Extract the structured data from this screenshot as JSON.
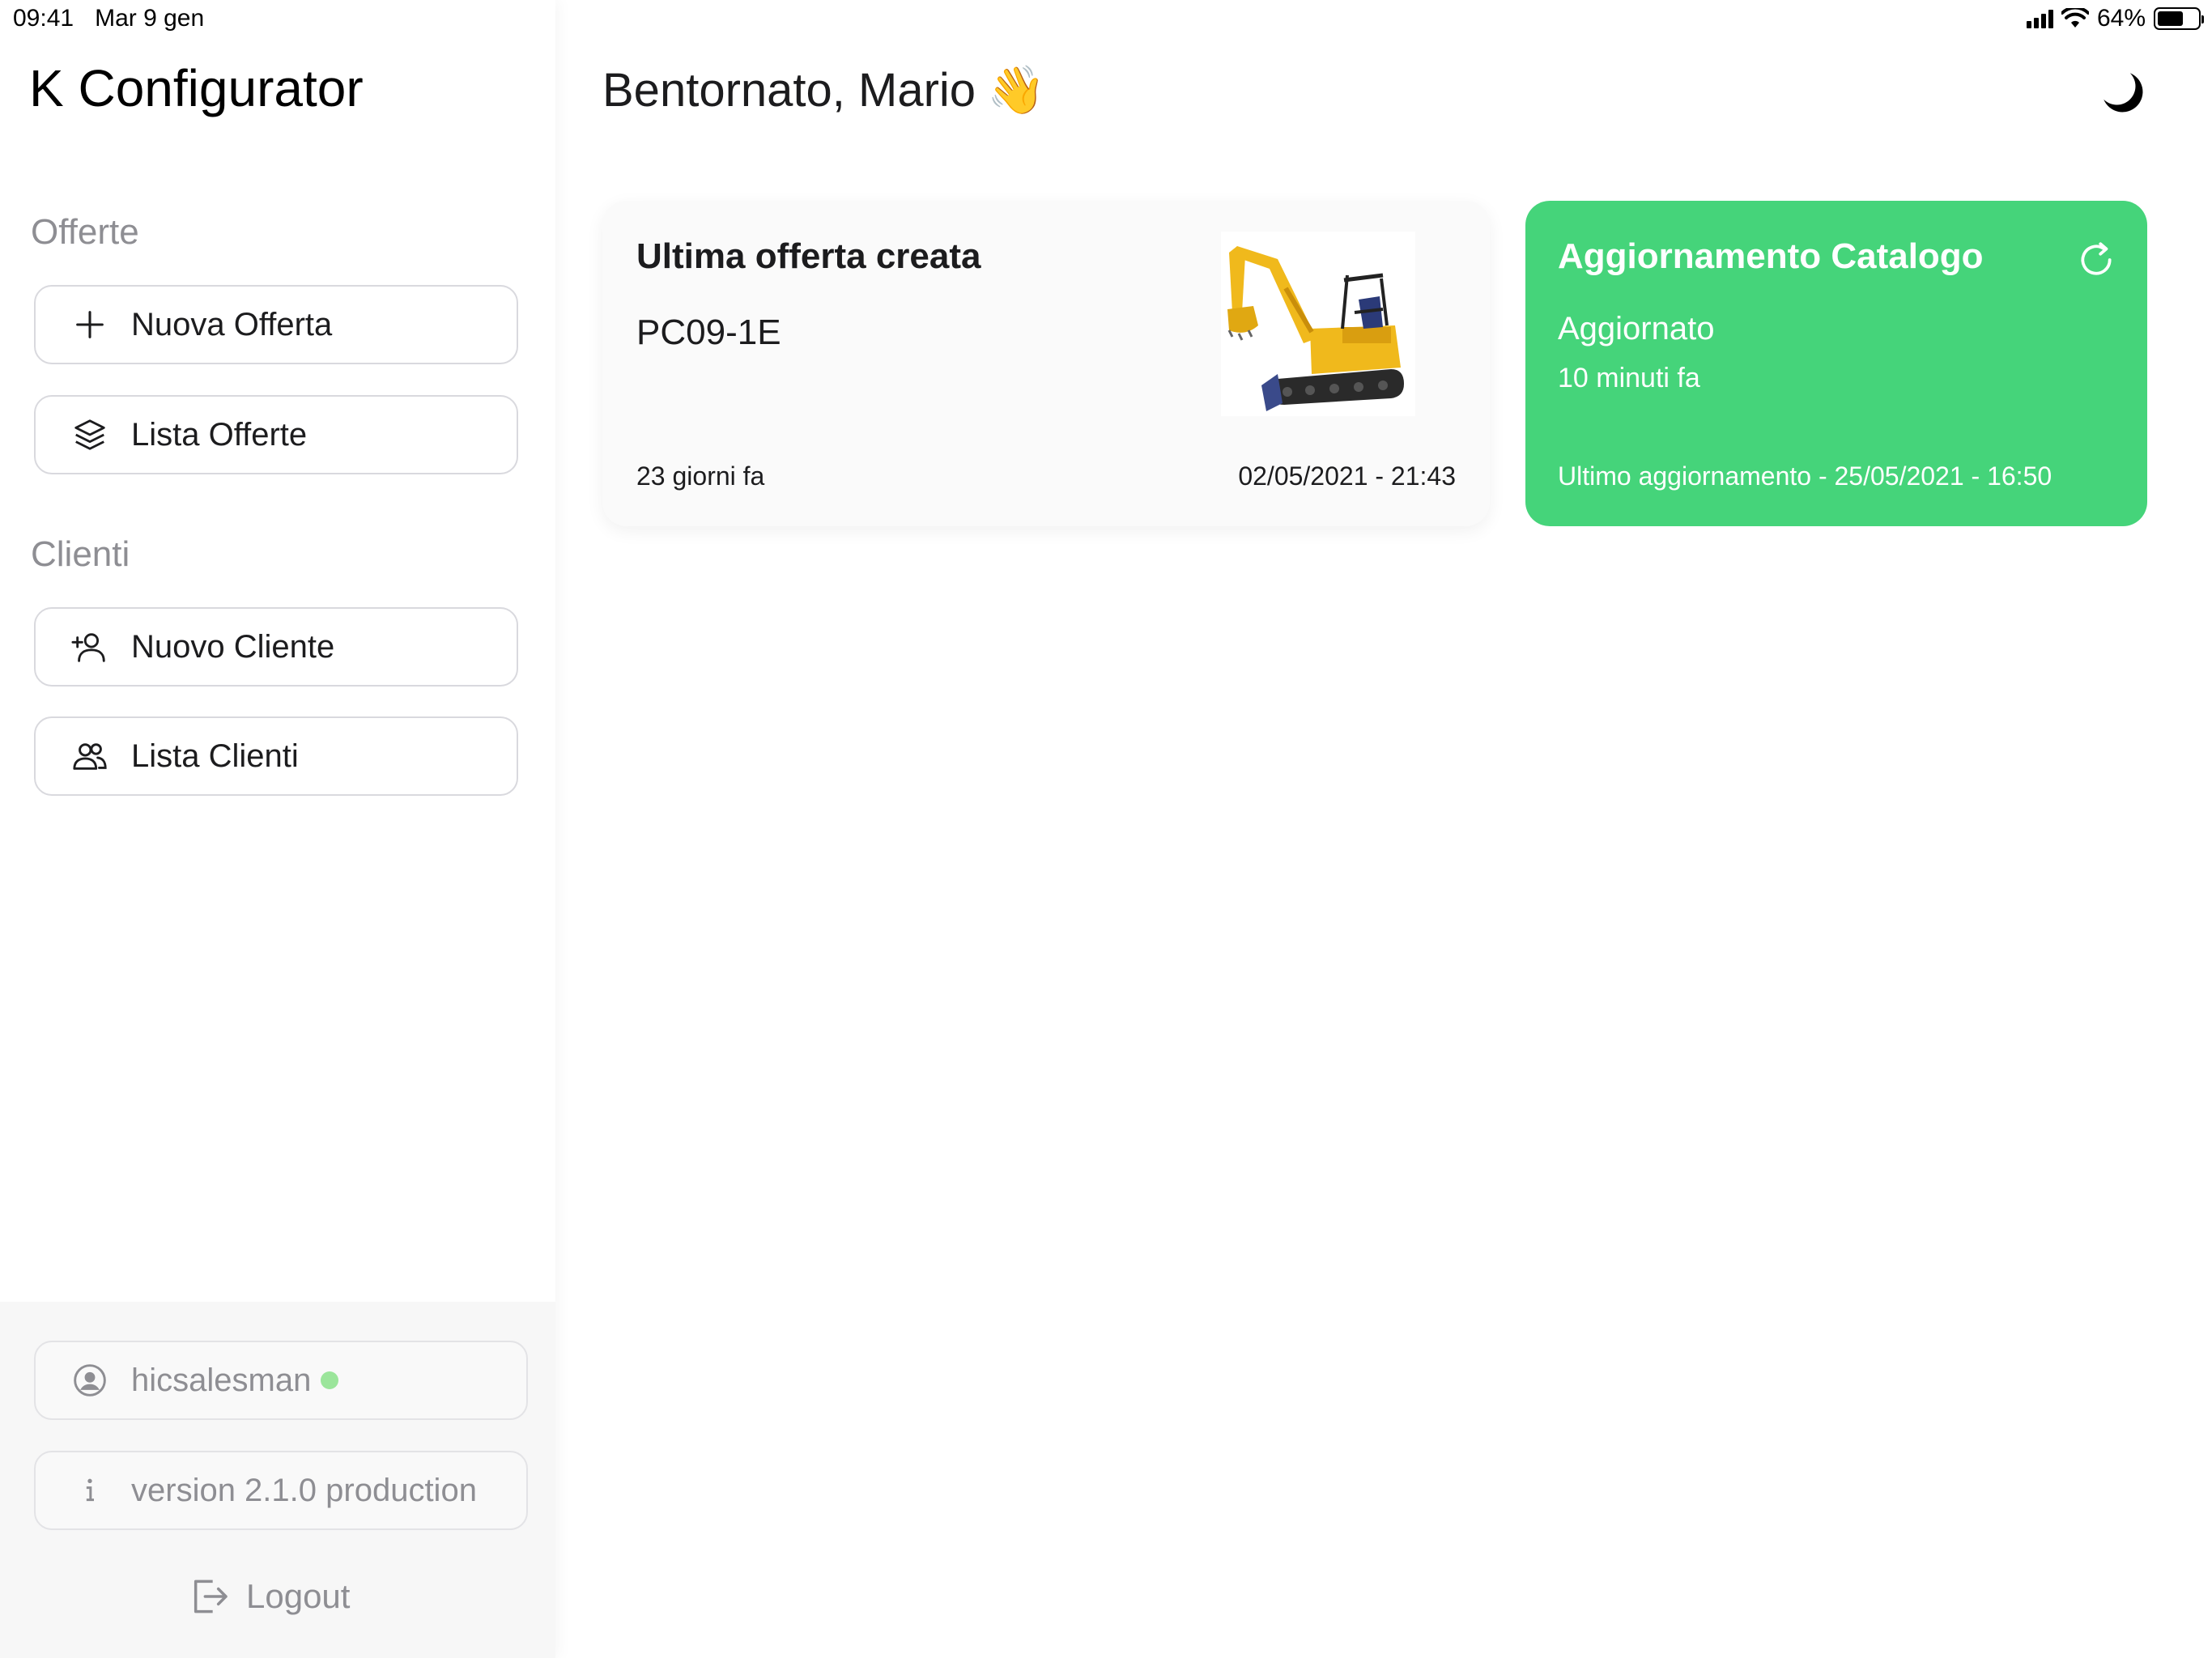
{
  "statusbar": {
    "time": "09:41",
    "date": "Mar 9 gen",
    "battery": "64%",
    "battery_level": 0.64
  },
  "sidebar": {
    "app_title": "K Configurator",
    "sections": [
      {
        "title": "Offerte",
        "items": [
          {
            "label": "Nuova Offerta",
            "icon": "plus-icon"
          },
          {
            "label": "Lista Offerte",
            "icon": "layers-icon"
          }
        ]
      },
      {
        "title": "Clienti",
        "items": [
          {
            "label": "Nuovo Cliente",
            "icon": "user-plus-icon"
          },
          {
            "label": "Lista Clienti",
            "icon": "users-icon"
          }
        ]
      }
    ],
    "footer": {
      "username": "hicsalesman",
      "online_color": "#9be59b",
      "version": "version 2.1.0 production",
      "logout_label": "Logout"
    }
  },
  "main": {
    "greeting": "Bentornato, Mario",
    "greeting_emoji": "👋",
    "last_offer": {
      "title": "Ultima offerta creata",
      "model": "PC09-1E",
      "ago": "23 giorni fa",
      "date": "02/05/2021 - 21:43"
    },
    "catalog": {
      "title": "Aggiornamento Catalogo",
      "status": "Aggiornato",
      "ago": "10 minuti fa",
      "last_update": "Ultimo aggiornamento - 25/05/2021 - 16:50",
      "color": "#45d47a"
    }
  }
}
